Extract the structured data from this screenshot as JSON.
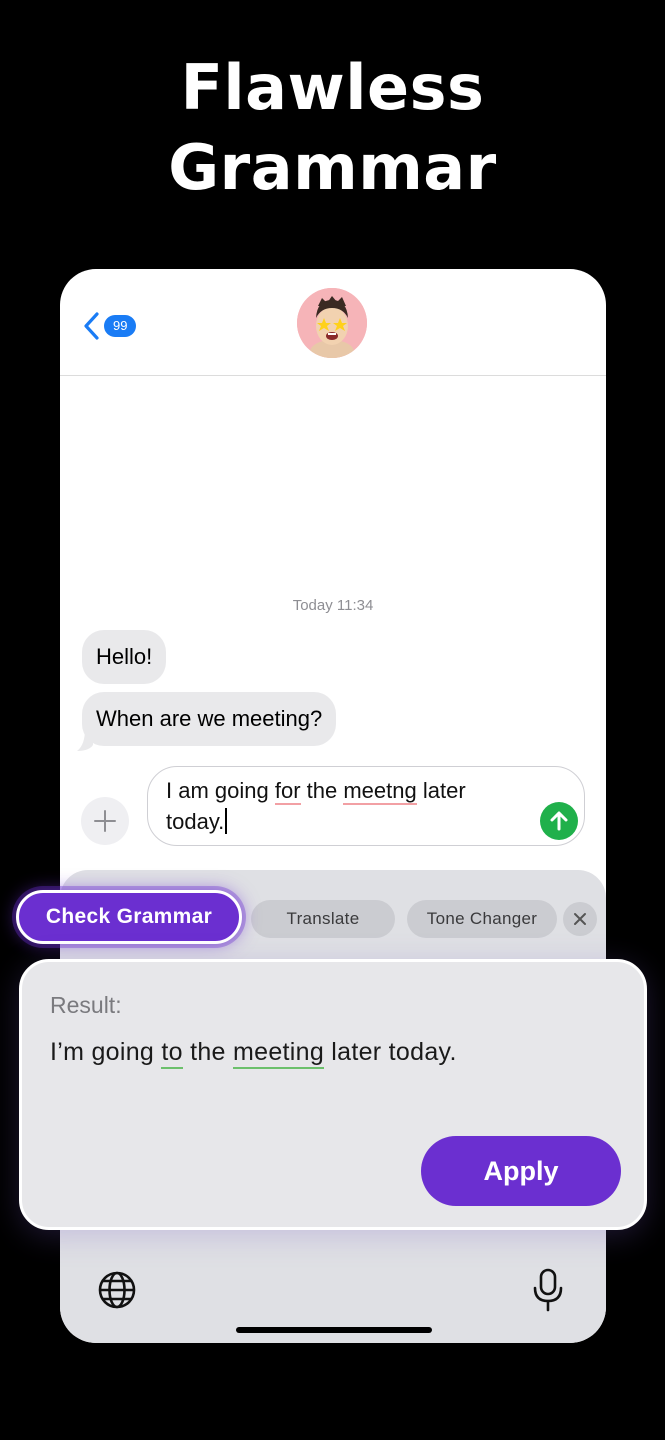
{
  "headline": {
    "line1": "Flawless",
    "line2": "Grammar"
  },
  "nav": {
    "back_badge": "99"
  },
  "chat": {
    "timestamp": "Today 11:34",
    "messages": [
      {
        "text": "Hello!"
      },
      {
        "text": "When are we meeting?"
      }
    ]
  },
  "composer": {
    "text_part1": "I am going ",
    "text_for": "for",
    "text_part2": " the ",
    "text_meetng": "meetng",
    "text_part3": " later",
    "text_line2": "today."
  },
  "toolbar": {
    "check_grammar": "Check Grammar",
    "translate": "Translate",
    "tone_changer": "Tone Changer"
  },
  "result": {
    "label": "Result:",
    "text_part1": "I’m going ",
    "text_to": "to",
    "text_part2": " the ",
    "text_meeting": "meeting",
    "text_part3": " later today.",
    "apply": "Apply"
  },
  "colors": {
    "accent": "#6b2fd0",
    "ios_blue": "#1a7cf5",
    "send_green": "#20b04b"
  }
}
